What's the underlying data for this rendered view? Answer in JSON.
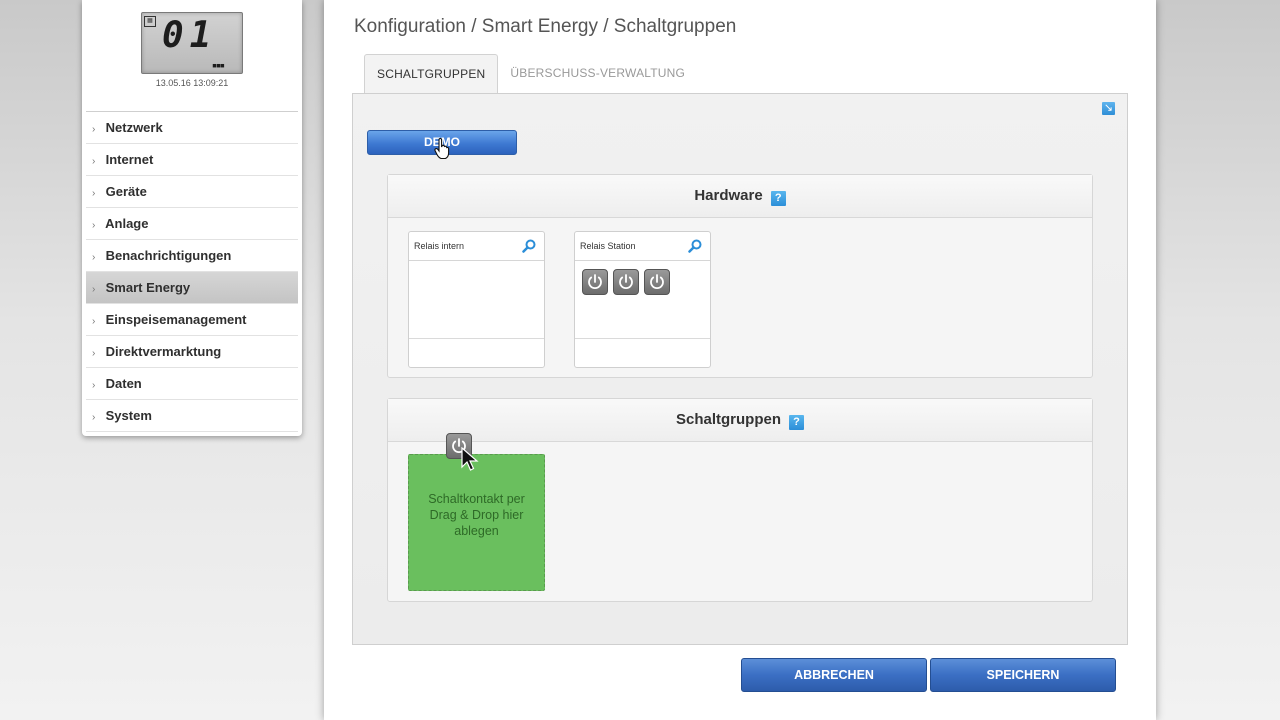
{
  "device": {
    "lcd_digits": "01",
    "lcd_dots": "▪▪▪",
    "datetime": "13.05.16 13:09:21"
  },
  "nav": {
    "items": [
      {
        "label": "Netzwerk"
      },
      {
        "label": "Internet"
      },
      {
        "label": "Geräte"
      },
      {
        "label": "Anlage"
      },
      {
        "label": "Benachrichtigungen"
      },
      {
        "label": "Smart Energy"
      },
      {
        "label": "Einspeisemanagement"
      },
      {
        "label": "Direktvermarktung"
      },
      {
        "label": "Daten"
      },
      {
        "label": "System"
      }
    ],
    "active": "Smart Energy"
  },
  "header": {
    "breadcrumb": "Konfiguration / Smart Energy / Schaltgruppen"
  },
  "tabs": [
    {
      "label": "SCHALTGRUPPEN",
      "active": true
    },
    {
      "label": "ÜBERSCHUSS-VERWALTUNG",
      "active": false
    }
  ],
  "content": {
    "demo_label": "DEMO",
    "hardware": {
      "title": "Hardware",
      "help": "?",
      "boxes": [
        {
          "title": "Relais intern",
          "relays": 0
        },
        {
          "title": "Relais Station",
          "relays": 3
        }
      ]
    },
    "schaltgruppen": {
      "title": "Schaltgruppen",
      "help": "?",
      "dropzone_text": "Schaltkontakt per Drag & Drop hier ablegen"
    }
  },
  "footer": {
    "cancel_label": "ABBRECHEN",
    "save_label": "SPEICHERN"
  },
  "colors": {
    "accent_blue": "#3b6fc4",
    "help_blue": "#2b8ed8",
    "dropzone_green": "#6abf5e"
  }
}
